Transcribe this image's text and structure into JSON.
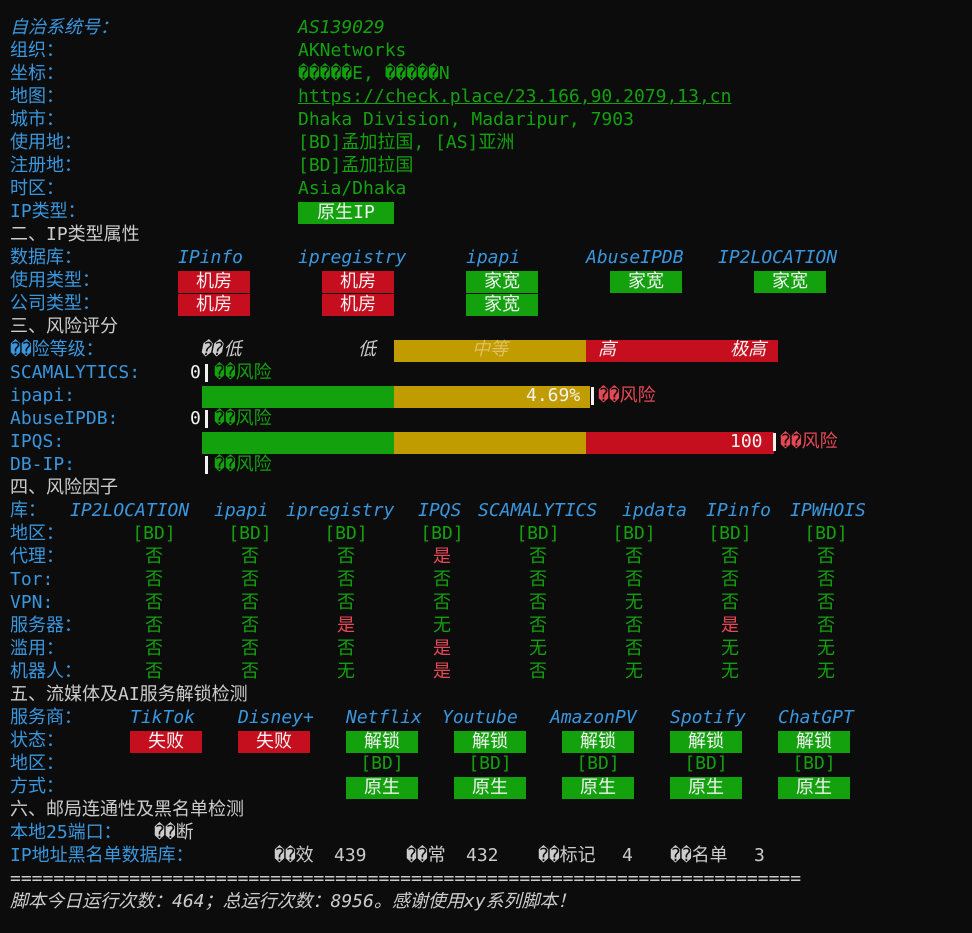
{
  "basic": {
    "asn": {
      "label": "自治系统号：",
      "value": "AS139029"
    },
    "org": {
      "label": "组织：",
      "value": "AKNetworks"
    },
    "coords": {
      "label": "坐标：",
      "value": "�����E, �����N"
    },
    "map": {
      "label": "地图：",
      "value": "https://check.place/23.166,90.2079,13,cn"
    },
    "city": {
      "label": "城市：",
      "value": "Dhaka Division, Madaripur, 7903"
    },
    "usage_loc": {
      "label": "使用地：",
      "value": "[BD]孟加拉国, [AS]亚洲"
    },
    "reg_loc": {
      "label": "注册地：",
      "value": "[BD]孟加拉国"
    },
    "timezone": {
      "label": "时区：",
      "value": "Asia/Dhaka"
    },
    "ip_type": {
      "label": "IP类型：",
      "value": "原生IP"
    }
  },
  "section2": {
    "title": "二、IP类型属性",
    "db_label": "数据库：",
    "dbs": [
      "IPinfo",
      "ipregistry",
      "ipapi",
      "AbuseIPDB",
      "IP2LOCATION"
    ],
    "usage_label": "使用类型：",
    "usage": [
      "机房",
      "机房",
      "家宽",
      "家宽",
      "家宽"
    ],
    "company_label": "公司类型：",
    "company": [
      "机房",
      "机房",
      "家宽"
    ]
  },
  "section3": {
    "title": "三、风险评分",
    "level_label": "��险等级：",
    "scale": [
      "��低",
      "低",
      "中等",
      "高",
      "极高"
    ],
    "rows": [
      {
        "label": "SCAMALYTICS:",
        "score": "0",
        "note": "��风险",
        "fraction": 0
      },
      {
        "label": "ipapi:",
        "score": "4.69%",
        "note": "��风险",
        "fraction": 0.0469
      },
      {
        "label": "AbuseIPDB:",
        "score": "0",
        "note": "��风险",
        "fraction": 0
      },
      {
        "label": "IPQS:",
        "score": "100",
        "note": "��风险",
        "fraction": 1
      },
      {
        "label": "DB-IP:",
        "score": "",
        "note": "��风险",
        "fraction": 0
      }
    ]
  },
  "section4": {
    "title": "四、风险因子",
    "lib_label": "库：",
    "libs": [
      "IP2LOCATION",
      "ipapi",
      "ipregistry",
      "IPQS",
      "SCAMALYTICS",
      "ipdata",
      "IPinfo",
      "IPWHOIS"
    ],
    "rows": [
      {
        "label": "地区：",
        "values": [
          "[BD]",
          "[BD]",
          "[BD]",
          "[BD]",
          "[BD]",
          "[BD]",
          "[BD]",
          "[BD]"
        ]
      },
      {
        "label": "代理：",
        "values": [
          "否",
          "否",
          "否",
          "是",
          "否",
          "否",
          "否",
          "否"
        ]
      },
      {
        "label": "Tor:",
        "values": [
          "否",
          "否",
          "否",
          "否",
          "否",
          "否",
          "否",
          "否"
        ]
      },
      {
        "label": "VPN:",
        "values": [
          "否",
          "否",
          "否",
          "否",
          "否",
          "无",
          "否",
          "否"
        ]
      },
      {
        "label": "服务器：",
        "values": [
          "否",
          "否",
          "是",
          "无",
          "否",
          "否",
          "是",
          "否"
        ]
      },
      {
        "label": "滥用：",
        "values": [
          "否",
          "否",
          "否",
          "是",
          "无",
          "否",
          "无",
          "无"
        ]
      },
      {
        "label": "机器人：",
        "values": [
          "否",
          "否",
          "无",
          "是",
          "否",
          "无",
          "无",
          "无"
        ]
      }
    ]
  },
  "section5": {
    "title": "五、流媒体及AI服务解锁检测",
    "provider_label": "服务商：",
    "providers": [
      "TikTok",
      "Disney+",
      "Netflix",
      "Youtube",
      "AmazonPV",
      "Spotify",
      "ChatGPT"
    ],
    "status_label": "状态：",
    "status": [
      "失败",
      "失败",
      "解锁",
      "解锁",
      "解锁",
      "解锁",
      "解锁"
    ],
    "region_label": "地区：",
    "regions": [
      "",
      "",
      "[BD]",
      "[BD]",
      "[BD]",
      "[BD]",
      "[BD]"
    ],
    "method_label": "方式：",
    "methods": [
      "",
      "",
      "原生",
      "原生",
      "原生",
      "原生",
      "原生"
    ]
  },
  "section6": {
    "title": "六、邮局连通性及黑名单检测",
    "port_label": "本地25端口：",
    "port_value": "��断",
    "bl_label": "IP地址黑名单数据库：",
    "bl_valid_label": "��效",
    "bl_valid": "439",
    "bl_normal_label": "��常",
    "bl_normal": "432",
    "bl_marked_label": "��标记",
    "bl_marked": "4",
    "bl_black_label": "��名单",
    "bl_black": "3"
  },
  "footer": {
    "divider": "=========================================================================",
    "text": "脚本今日运行次数：464；总运行次数：8956。感谢使用xy系列脚本！"
  },
  "colors": {
    "background": "#0c0c0c",
    "label_blue": "#3a96dd",
    "value_green": "#13a10e",
    "fail_red": "#c50f1f",
    "mid_gold": "#c19c00"
  }
}
